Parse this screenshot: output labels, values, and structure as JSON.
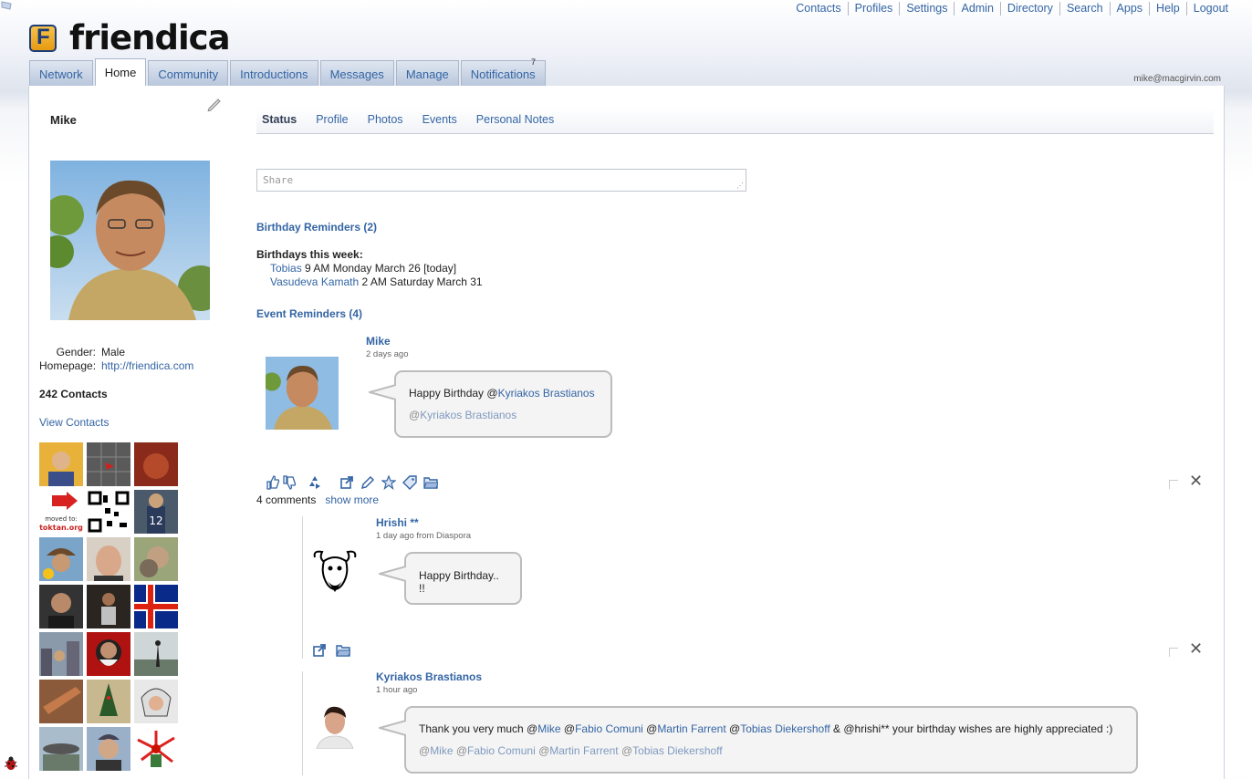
{
  "topnav": [
    "Contacts",
    "Profiles",
    "Settings",
    "Admin",
    "Directory",
    "Search",
    "Apps",
    "Help",
    "Logout"
  ],
  "logo": {
    "letter": "F",
    "text": "friendica"
  },
  "tabs": [
    {
      "label": "Network",
      "active": false
    },
    {
      "label": "Home",
      "active": true
    },
    {
      "label": "Community",
      "active": false
    },
    {
      "label": "Introductions",
      "active": false
    },
    {
      "label": "Messages",
      "active": false
    },
    {
      "label": "Manage",
      "active": false
    },
    {
      "label": "Notifications",
      "active": false
    }
  ],
  "notifications_count": "7",
  "user_email": "mike@macgirvin.com",
  "profile": {
    "name": "Mike",
    "gender_label": "Gender:",
    "gender": "Male",
    "homepage_label": "Homepage:",
    "homepage": "http://friendica.com",
    "contacts_count": "242 Contacts",
    "view_contacts": "View Contacts"
  },
  "subtabs": [
    "Status",
    "Profile",
    "Photos",
    "Events",
    "Personal Notes"
  ],
  "share_placeholder": "Share",
  "reminders": {
    "birthday_title": "Birthday Reminders (2)",
    "birthdays_week": "Birthdays this week:",
    "birthdays": [
      {
        "name": "Tobias",
        "when": " 9 AM Monday March 26 [today]"
      },
      {
        "name": "Vasudeva Kamath",
        "when": " 2 AM Saturday March 31"
      }
    ],
    "event_title": "Event Reminders (4)"
  },
  "post": {
    "author": "Mike",
    "ago": "2 days ago",
    "text_prefix": "Happy Birthday @",
    "mention": "Kyriakos Brastianos",
    "tag_at": "@",
    "tag": "Kyriakos Brastianos",
    "comments_count": "4 comments",
    "show_more": "show more"
  },
  "comments": [
    {
      "author": "Hrishi **",
      "ago": "1 day ago from Diaspora",
      "text": "Happy Birthday.. !!"
    },
    {
      "author": "Kyriakos Brastianos",
      "ago": "1 hour ago",
      "t1": "Thank you very much @",
      "m1": "Mike",
      "t2": " @",
      "m2": "Fabio Comuni",
      "t3": " @",
      "m3": "Martin Farrent",
      "t4": " @",
      "m4": "Tobias Diekershoff",
      "t5": " & @hrishi** your birthday wishes are highly appreciated :)",
      "tags": [
        {
          "at": "@",
          "name": "Mike"
        },
        {
          "at": " @",
          "name": "Fabio Comuni"
        },
        {
          "at": " @",
          "name": "Martin Farrent"
        },
        {
          "at": " @",
          "name": "Tobias Diekershoff"
        }
      ]
    }
  ],
  "colors": {
    "link": "#3465a4",
    "tab_bg": "#b9c7dc",
    "bubble_bg": "#f4f4f4"
  },
  "icons": [
    "like-icon",
    "dislike-icon",
    "share-recycle-icon",
    "external-link-icon",
    "edit-icon",
    "star-icon",
    "tag-icon",
    "folder-icon",
    "close-icon",
    "checkbox-icon",
    "bug-icon"
  ]
}
